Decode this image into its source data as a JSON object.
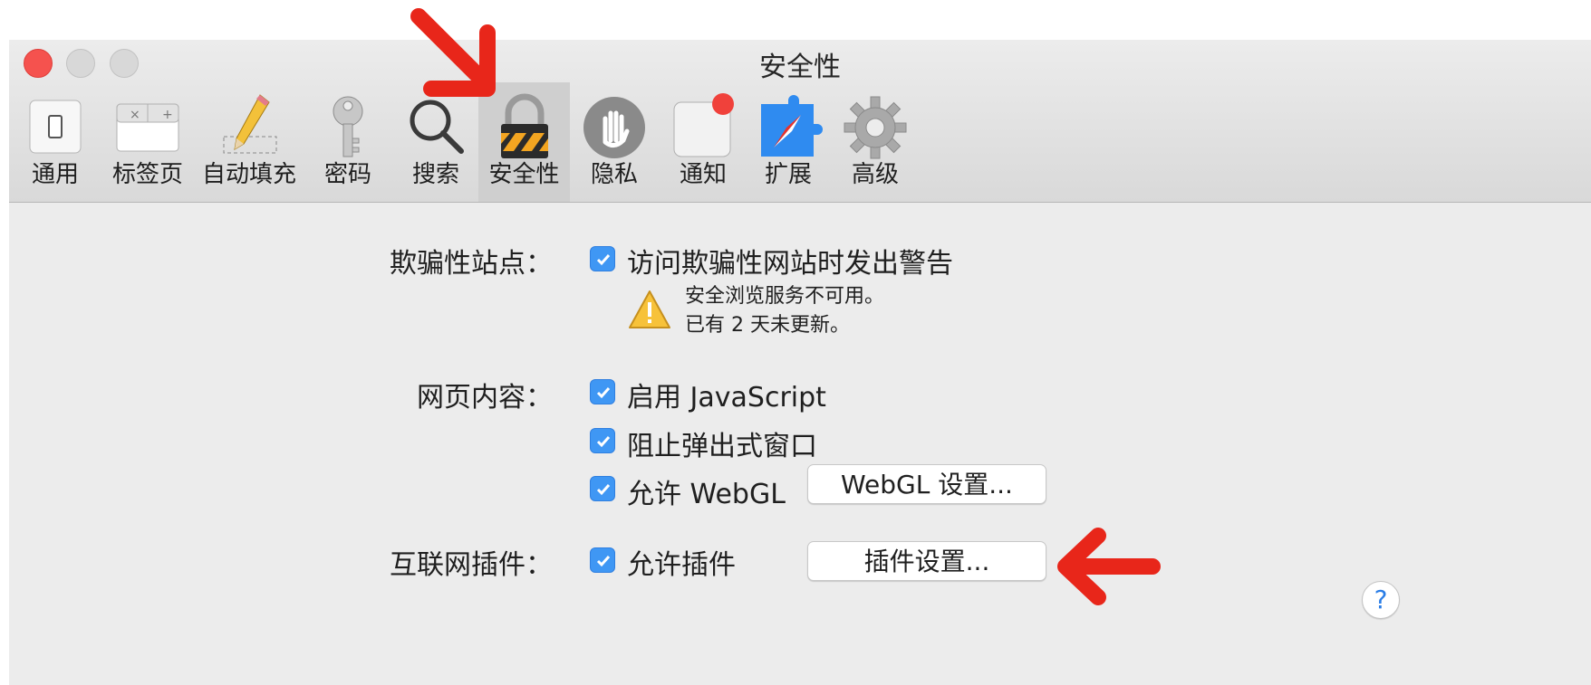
{
  "window": {
    "title": "安全性"
  },
  "toolbar": {
    "tabs": [
      {
        "label": "通用",
        "icon": "switch-icon"
      },
      {
        "label": "标签页",
        "icon": "tabs-icon"
      },
      {
        "label": "自动填充",
        "icon": "pencil-icon"
      },
      {
        "label": "密码",
        "icon": "key-icon"
      },
      {
        "label": "搜索",
        "icon": "magnifier-icon"
      },
      {
        "label": "安全性",
        "icon": "padlock-icon",
        "active": true
      },
      {
        "label": "隐私",
        "icon": "hand-icon"
      },
      {
        "label": "通知",
        "icon": "notification-icon"
      },
      {
        "label": "扩展",
        "icon": "extension-icon"
      },
      {
        "label": "高级",
        "icon": "gear-icon"
      }
    ]
  },
  "fraud": {
    "label": "欺骗性站点：",
    "checkbox": "访问欺骗性网站时发出警告",
    "warning_line1": "安全浏览服务不可用。",
    "warning_line2": "已有 2 天未更新。"
  },
  "web_content": {
    "label": "网页内容：",
    "javascript": "启用 JavaScript",
    "popups": "阻止弹出式窗口",
    "webgl": "允许 WebGL",
    "webgl_button": "WebGL 设置..."
  },
  "plugins": {
    "label": "互联网插件：",
    "checkbox": "允许插件",
    "button": "插件设置..."
  },
  "help": {
    "label": "?"
  },
  "colors": {
    "accent": "#3f97f4",
    "close": "#f5524e",
    "annotation_arrow": "#e8261a"
  }
}
